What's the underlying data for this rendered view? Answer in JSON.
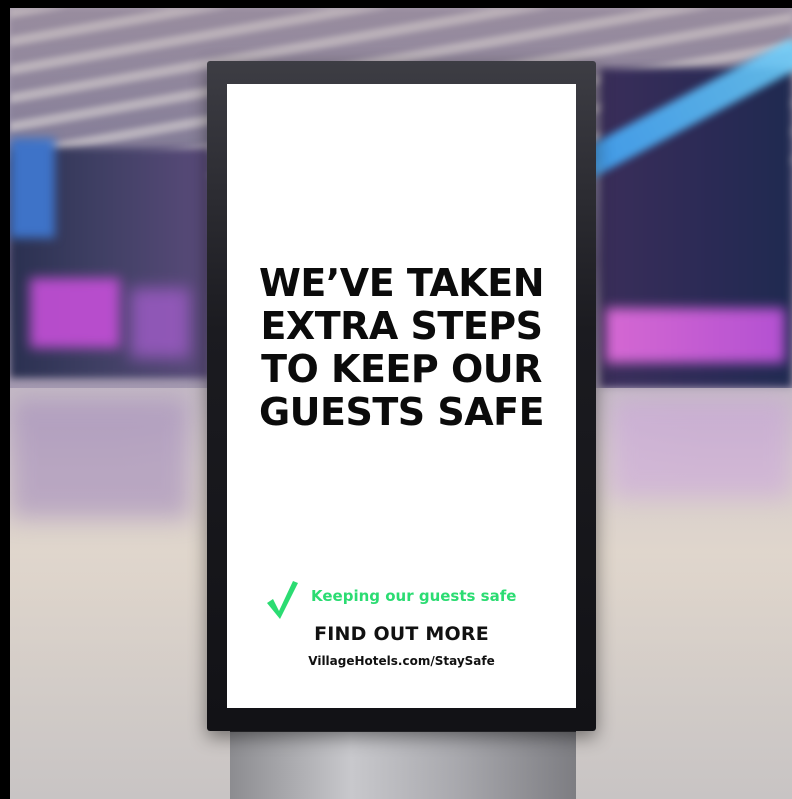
{
  "sign": {
    "headline_lines": [
      "WE’VE TAKEN",
      "EXTRA STEPS",
      "TO KEEP OUR",
      "GUESTS SAFE"
    ],
    "check_icon": "check-icon",
    "check_text": "Keeping our guests safe",
    "cta": "FIND OUT MORE",
    "url": "VillageHotels.com/StaySafe"
  },
  "colors": {
    "accent_green": "#2bdc72",
    "headline": "#0b0b0b",
    "screen_bg": "#ffffff",
    "bezel": "#1b1b20"
  }
}
